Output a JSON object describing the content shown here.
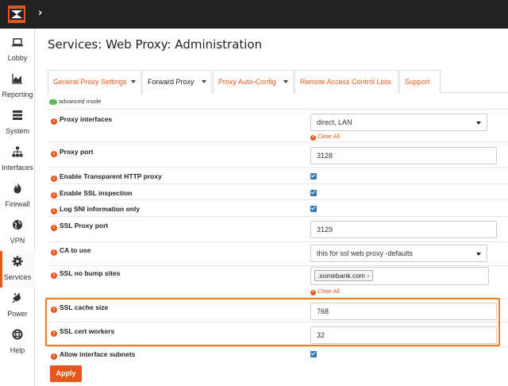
{
  "header": {
    "chevron": "›"
  },
  "sidebar": {
    "items": [
      {
        "label": "Lobby",
        "icon": "laptop-icon"
      },
      {
        "label": "Reporting",
        "icon": "area-chart-icon"
      },
      {
        "label": "System",
        "icon": "server-icon"
      },
      {
        "label": "Interfaces",
        "icon": "sitemap-icon"
      },
      {
        "label": "Firewall",
        "icon": "fire-icon"
      },
      {
        "label": "VPN",
        "icon": "globe-icon"
      },
      {
        "label": "Services",
        "icon": "gear-icon"
      },
      {
        "label": "Power",
        "icon": "plug-icon"
      },
      {
        "label": "Help",
        "icon": "lifebuoy-icon"
      }
    ]
  },
  "page": {
    "title": "Services: Web Proxy: Administration"
  },
  "tabs": [
    {
      "label": "General Proxy Settings",
      "dropdown": true
    },
    {
      "label": "Forward Proxy",
      "dropdown": true,
      "active": true
    },
    {
      "label": "Proxy Auto-Config",
      "dropdown": true
    },
    {
      "label": "Remote Access Control Lists",
      "dropdown": false
    },
    {
      "label": "Support",
      "dropdown": false
    }
  ],
  "advanced_mode": {
    "label": "advanced mode"
  },
  "form": {
    "proxy_interfaces": {
      "label": "Proxy interfaces",
      "value": "direct, LAN",
      "clear": "Clear All"
    },
    "proxy_port": {
      "label": "Proxy port",
      "value": "3128"
    },
    "transparent": {
      "label": "Enable Transparent HTTP proxy",
      "checked": true
    },
    "ssl_inspection": {
      "label": "Enable SSL inspection",
      "checked": true
    },
    "log_sni": {
      "label": "Log SNI information only",
      "checked": true
    },
    "ssl_proxy_port": {
      "label": "SSL Proxy port",
      "value": "3129"
    },
    "ca_to_use": {
      "label": "CA to use",
      "value": "this for ssl web proxy -defaults"
    },
    "ssl_no_bump": {
      "label": "SSL no bump sites",
      "tag": ".somebank.com",
      "tag_remove": "×",
      "clear": "Clear All"
    },
    "ssl_cache_size": {
      "label": "SSL cache size",
      "value": "768"
    },
    "ssl_cert_workers": {
      "label": "SSL cert workers",
      "value": "32"
    },
    "allow_subnets": {
      "label": "Allow interface subnets",
      "checked": true
    }
  },
  "apply_label": "Apply",
  "colors": {
    "accent": "#e5571a",
    "highlight": "#f07a1a",
    "topbar": "#222222",
    "checkbox": "#337ab7"
  }
}
